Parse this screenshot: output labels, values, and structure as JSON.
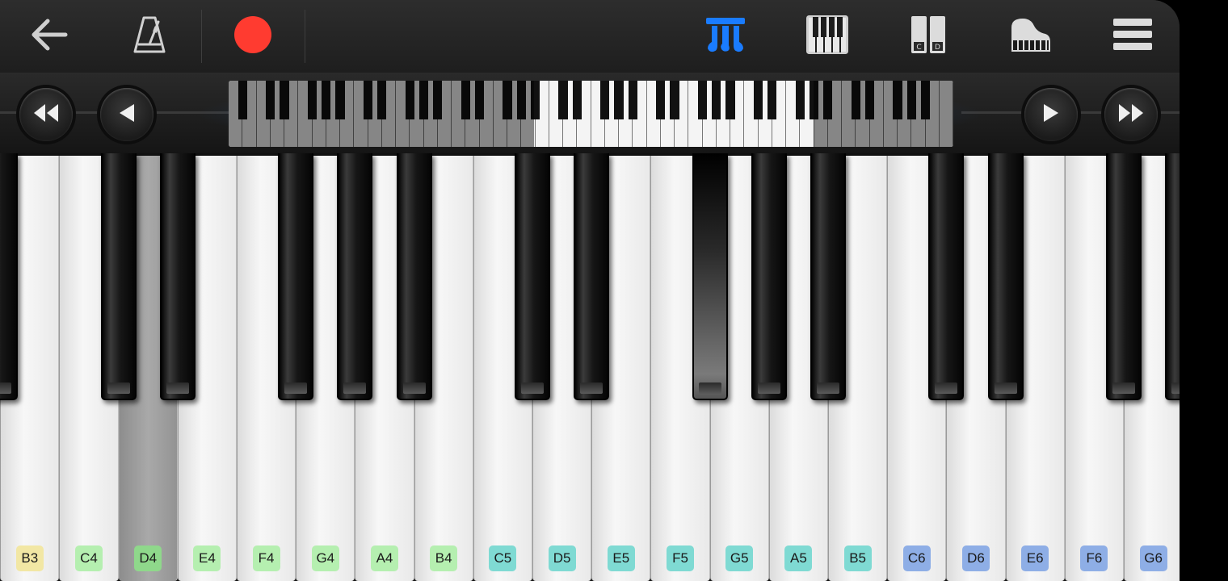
{
  "toolbar": {
    "back_icon": "arrow-left-icon",
    "metronome_icon": "metronome-icon",
    "record_icon": "record-icon",
    "mode_icon": "piano-keys-blue-icon",
    "single_keyboard_icon": "keyboard-icon",
    "note_labels_icon": "note-labels-cd-icon",
    "instrument_icon": "grand-piano-icon",
    "menu_icon": "hamburger-menu-icon",
    "record_color": "#ff3b30",
    "active_color": "#1a7cff"
  },
  "navigation": {
    "icons": [
      "fast-rewind-icon",
      "rewind-icon",
      "play-icon",
      "fast-forward-icon"
    ]
  },
  "keyboard": {
    "white_keys": [
      {
        "note": "",
        "label_color": ""
      },
      {
        "note": "B3",
        "label_color": "#f2e7a4"
      },
      {
        "note": "C4",
        "label_color": "#b5efb0"
      },
      {
        "note": "D4",
        "label_color": "#8fd88b"
      },
      {
        "note": "E4",
        "label_color": "#b5efb0"
      },
      {
        "note": "F4",
        "label_color": "#b5efb0"
      },
      {
        "note": "G4",
        "label_color": "#b5efb0"
      },
      {
        "note": "A4",
        "label_color": "#b5efb0"
      },
      {
        "note": "B4",
        "label_color": "#b5efb0"
      },
      {
        "note": "C5",
        "label_color": "#7fdad3"
      },
      {
        "note": "D5",
        "label_color": "#7fdad3"
      },
      {
        "note": "E5",
        "label_color": "#7fdad3"
      },
      {
        "note": "F5",
        "label_color": "#7fdad3"
      },
      {
        "note": "G5",
        "label_color": "#7fdad3"
      },
      {
        "note": "A5",
        "label_color": "#7fdad3"
      },
      {
        "note": "B5",
        "label_color": "#7fdad3"
      },
      {
        "note": "C6",
        "label_color": "#8eaee6"
      },
      {
        "note": "D6",
        "label_color": "#8eaee6"
      },
      {
        "note": "E6",
        "label_color": "#8eaee6"
      },
      {
        "note": "F6",
        "label_color": "#8eaee6"
      },
      {
        "note": "G6",
        "label_color": "#8eaee6"
      }
    ],
    "pressed_notes": [
      "D4",
      "F#5"
    ]
  }
}
